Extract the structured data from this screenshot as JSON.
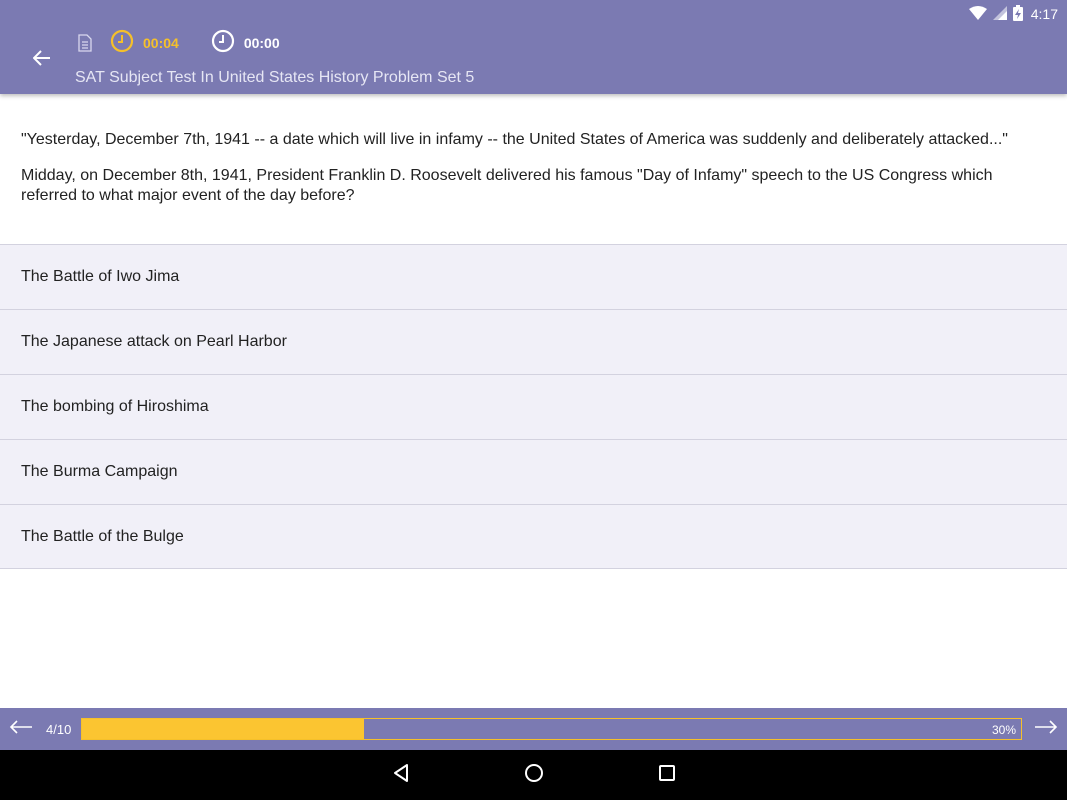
{
  "status_bar": {
    "time": "4:17",
    "icons": [
      "wifi-icon",
      "signal-icon",
      "battery-charging-icon"
    ]
  },
  "header": {
    "timer_active": "00:04",
    "timer_total": "00:00",
    "title": "SAT Subject Test In United States History Problem Set 5",
    "icons": [
      "back-arrow-icon",
      "document-icon",
      "clock-icon"
    ]
  },
  "question": {
    "quote": "\"Yesterday, December 7th, 1941 -- a date which will live in infamy -- the United States of America was suddenly and deliberately attacked...\"",
    "prompt": "Midday, on December 8th, 1941, President Franklin D. Roosevelt delivered his famous \"Day of Infamy\" speech to the US Congress which referred to what major event of the day before?"
  },
  "answers": [
    "The Battle of Iwo Jima",
    "The Japanese attack on Pearl Harbor",
    "The bombing of Hiroshima",
    "The Burma Campaign",
    "The Battle of the Bulge"
  ],
  "progress": {
    "page": "4/10",
    "percent_label": "30%",
    "fill_fraction": 0.3
  },
  "colors": {
    "primary": "#7b7ab2",
    "accent": "#fbc531",
    "answer_bg": "#f1f0f8"
  }
}
